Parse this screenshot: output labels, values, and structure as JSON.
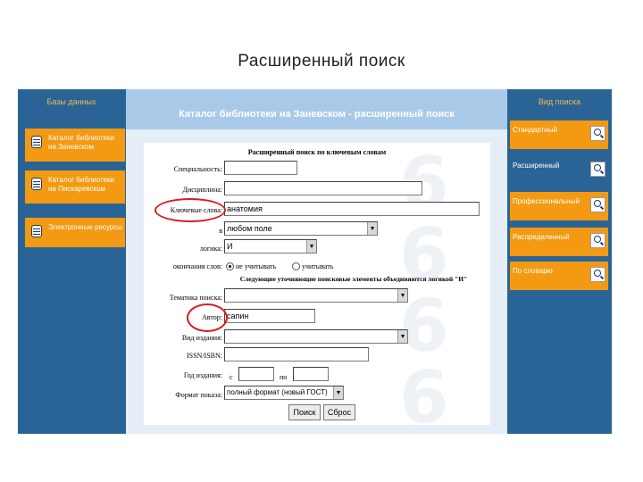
{
  "slide": {
    "title": "Расширенный поиск"
  },
  "left_sidebar": {
    "header": "Базы данных",
    "items": [
      {
        "label": "Каталог библиотеки на Заневском"
      },
      {
        "label": "Каталог библиотеки на Пискаревском"
      },
      {
        "label": "Электронные ресурсы"
      }
    ]
  },
  "panel": {
    "title": "Каталог библиотеки на Заневском - расширенный поиск"
  },
  "form": {
    "title": "Расширенный поиск по ключевым словам",
    "specialty_label": "Специальность:",
    "specialty_value": "",
    "discipline_label": "Дисциплина:",
    "discipline_value": "",
    "keywords_label": "Ключевые слова:",
    "keywords_value": "анатомия",
    "in_label": "в",
    "in_value": "любом поле",
    "logic_label": "логика:",
    "logic_value": "И",
    "endings_label": "окончания слов:",
    "endings_option1": "не учитывать",
    "endings_option2": "учитывать",
    "refine_note": "Следующие уточняющие поисковые элементы объединяются логикой \"И\"",
    "theme_label": "Тематика поиска:",
    "theme_value": "",
    "author_label": "Автор:",
    "author_value": "сапин",
    "pubtype_label": "Вид издания:",
    "pubtype_value": "",
    "isbn_label": "ISSN/ISBN:",
    "isbn_value": "",
    "year_label": "Год издания:",
    "year_from_label": "с",
    "year_from_value": "",
    "year_to_label": "по",
    "year_to_value": "",
    "format_label": "Формат показа:",
    "format_value": "полный формат (новый ГОСТ)",
    "search_button": "Поиск",
    "reset_button": "Сброс"
  },
  "right_sidebar": {
    "header": "Вид поиска",
    "items": [
      {
        "label": "Стандартный"
      },
      {
        "label": "Расширенный"
      },
      {
        "label": "Профессиональный"
      },
      {
        "label": "Распределенный"
      },
      {
        "label": "По словарю"
      }
    ]
  },
  "colors": {
    "accent_orange": "#f39a12",
    "frame_blue": "#2a6496",
    "highlight_red": "#d91d1d"
  }
}
